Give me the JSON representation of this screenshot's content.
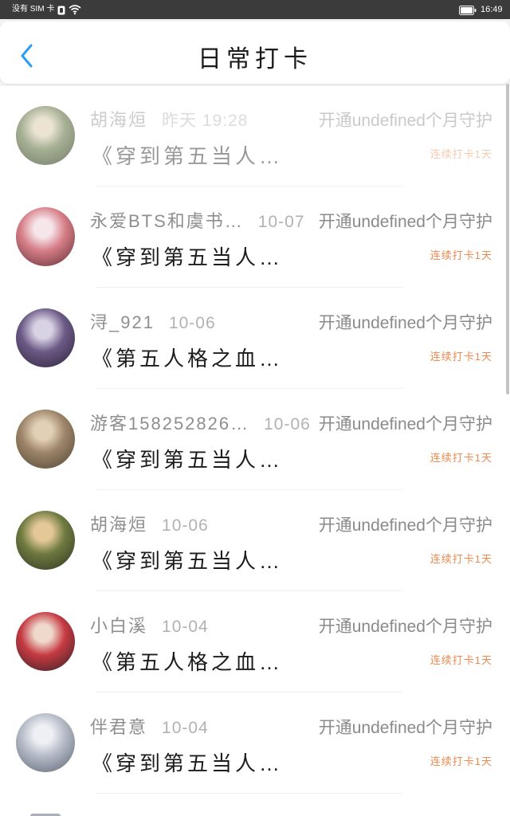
{
  "status_bar": {
    "carrier": "没有 SIM 卡",
    "time": "16:49",
    "icons": [
      "sim-card-icon",
      "wifi-icon",
      "battery-icon"
    ]
  },
  "header": {
    "title": "日常打卡",
    "back_icon": "back-chevron-icon"
  },
  "colors": {
    "accent": "#2a9df4",
    "streak": "#ec8a50",
    "status_bar": "#3b3b3b"
  },
  "list": {
    "items": [
      {
        "name": "胡海烜",
        "time": "昨天 19:28",
        "title": "《穿到第五当人…",
        "guard": "开通undefined个月守护",
        "streak": "连续打卡1天",
        "avatar_colors": [
          "#e6ddc8",
          "#8f9c78",
          "#4f5a44"
        ]
      },
      {
        "name": "永爱BTS和虞书…",
        "time": "10-07",
        "title": "《穿到第五当人…",
        "guard": "开通undefined个月守护",
        "streak": "连续打卡1天",
        "avatar_colors": [
          "#f6e6ea",
          "#d77f88",
          "#5a2a30"
        ]
      },
      {
        "name": "浔_921",
        "time": "10-06",
        "title": "《第五人格之血…",
        "guard": "开通undefined个月守护",
        "streak": "连续打卡1天",
        "avatar_colors": [
          "#d9d2e4",
          "#6c5a86",
          "#2a2136"
        ]
      },
      {
        "name": "游客158252826…",
        "time": "10-06",
        "title": "《穿到第五当人…",
        "guard": "开通undefined个月守护",
        "streak": "连续打卡1天",
        "avatar_colors": [
          "#e2d0b6",
          "#9c8468",
          "#4e4234"
        ]
      },
      {
        "name": "胡海烜",
        "time": "10-06",
        "title": "《穿到第五当人…",
        "guard": "开通undefined个月守护",
        "streak": "连续打卡1天",
        "avatar_colors": [
          "#e4c898",
          "#6e7a40",
          "#2c3020"
        ]
      },
      {
        "name": "小白溪",
        "time": "10-04",
        "title": "《第五人格之血…",
        "guard": "开通undefined个月守护",
        "streak": "连续打卡1天",
        "avatar_colors": [
          "#efd8cc",
          "#c63a42",
          "#2a2024"
        ]
      },
      {
        "name": "伴君意",
        "time": "10-04",
        "title": "《穿到第五当人…",
        "guard": "开通undefined个月守护",
        "streak": "连续打卡1天",
        "avatar_colors": [
          "#eef0f4",
          "#b4bac6",
          "#5a6270"
        ]
      }
    ]
  }
}
